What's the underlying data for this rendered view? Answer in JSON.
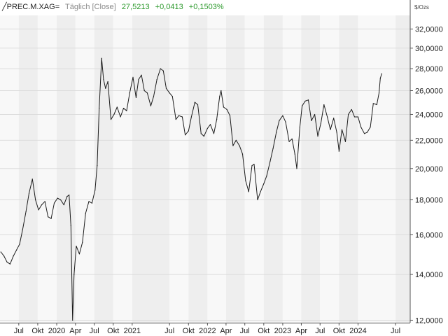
{
  "header": {
    "symbol": "╱PREC.M.XAG=",
    "period": "Täglich [Close]",
    "last": "27,5213",
    "change": "+0,0413",
    "change_pct": "+0,1503%"
  },
  "colors": {
    "line": "#1a1a1a",
    "band_light": "#f8f8f8",
    "band_dark": "#eeeeee",
    "grid": "#dcdcdc",
    "up": "#2e9a2e"
  },
  "chart_data": {
    "type": "line",
    "y_unit": "$/Ozs",
    "scale": "log",
    "ylim": [
      11.9,
      33.5
    ],
    "xlim": [
      "2019-04-01",
      "2024-09-10"
    ],
    "y_ticks": [
      "12,0000",
      "14,0000",
      "16,0000",
      "18,0000",
      "20,0000",
      "22,0000",
      "24,0000",
      "26,0000",
      "28,0000",
      "30,0000",
      "32,0000"
    ],
    "y_tick_values": [
      12,
      14,
      16,
      18,
      20,
      22,
      24,
      26,
      28,
      30,
      32
    ],
    "x_ticks": [
      {
        "date": "2019-07-01",
        "label": "Jul"
      },
      {
        "date": "2019-10-01",
        "label": "Okt"
      },
      {
        "date": "2020-01-01",
        "label": "2020"
      },
      {
        "date": "2020-04-01",
        "label": "Apr"
      },
      {
        "date": "2020-07-01",
        "label": "Jul"
      },
      {
        "date": "2020-10-01",
        "label": "Okt"
      },
      {
        "date": "2021-01-01",
        "label": "2021"
      },
      {
        "date": "2021-07-01",
        "label": "Jul"
      },
      {
        "date": "2021-10-01",
        "label": "Okt"
      },
      {
        "date": "2022-01-01",
        "label": "2022"
      },
      {
        "date": "2022-04-01",
        "label": "Apr"
      },
      {
        "date": "2022-07-01",
        "label": "Jul"
      },
      {
        "date": "2022-10-01",
        "label": "Okt"
      },
      {
        "date": "2023-01-01",
        "label": "2023"
      },
      {
        "date": "2023-04-01",
        "label": "Apr"
      },
      {
        "date": "2023-07-01",
        "label": "Jul"
      },
      {
        "date": "2023-10-01",
        "label": "Okt"
      },
      {
        "date": "2024-01-01",
        "label": "2024"
      },
      {
        "date": "2024-07-01",
        "label": "Jul"
      }
    ],
    "grid": true,
    "series": [
      {
        "x": [
          "2019-04-05",
          "2019-04-20",
          "2019-05-05",
          "2019-05-20",
          "2019-06-05",
          "2019-06-20",
          "2019-07-05",
          "2019-07-20",
          "2019-08-05",
          "2019-08-20",
          "2019-09-05",
          "2019-09-20",
          "2019-10-05",
          "2019-10-20",
          "2019-11-05",
          "2019-11-20",
          "2019-12-05",
          "2019-12-20",
          "2020-01-05",
          "2020-01-20",
          "2020-02-05",
          "2020-02-20",
          "2020-03-01",
          "2020-03-10",
          "2020-03-18",
          "2020-03-25",
          "2020-04-05",
          "2020-04-20",
          "2020-05-05",
          "2020-05-20",
          "2020-06-05",
          "2020-06-20",
          "2020-07-05",
          "2020-07-15",
          "2020-07-25",
          "2020-08-06",
          "2020-08-15",
          "2020-08-25",
          "2020-09-05",
          "2020-09-20",
          "2020-10-05",
          "2020-10-20",
          "2020-11-05",
          "2020-11-20",
          "2020-12-05",
          "2020-12-20",
          "2021-01-05",
          "2021-01-20",
          "2021-02-01",
          "2021-02-15",
          "2021-03-01",
          "2021-03-15",
          "2021-04-01",
          "2021-04-15",
          "2021-05-01",
          "2021-05-18",
          "2021-06-01",
          "2021-06-15",
          "2021-07-01",
          "2021-07-15",
          "2021-08-01",
          "2021-08-15",
          "2021-09-01",
          "2021-09-15",
          "2021-10-01",
          "2021-10-15",
          "2021-11-01",
          "2021-11-15",
          "2021-12-01",
          "2021-12-15",
          "2022-01-01",
          "2022-01-15",
          "2022-02-01",
          "2022-02-15",
          "2022-03-01",
          "2022-03-08",
          "2022-03-20",
          "2022-04-05",
          "2022-04-20",
          "2022-05-05",
          "2022-05-20",
          "2022-06-05",
          "2022-06-20",
          "2022-07-05",
          "2022-07-20",
          "2022-08-05",
          "2022-08-15",
          "2022-09-01",
          "2022-09-15",
          "2022-10-01",
          "2022-10-15",
          "2022-11-01",
          "2022-11-15",
          "2022-12-01",
          "2022-12-15",
          "2023-01-01",
          "2023-01-15",
          "2023-02-01",
          "2023-02-15",
          "2023-03-01",
          "2023-03-10",
          "2023-03-25",
          "2023-04-05",
          "2023-04-20",
          "2023-05-05",
          "2023-05-20",
          "2023-06-05",
          "2023-06-20",
          "2023-07-05",
          "2023-07-20",
          "2023-08-05",
          "2023-08-20",
          "2023-09-05",
          "2023-09-20",
          "2023-10-01",
          "2023-10-15",
          "2023-11-01",
          "2023-11-15",
          "2023-12-01",
          "2023-12-15",
          "2024-01-01",
          "2024-01-15",
          "2024-02-01",
          "2024-02-15",
          "2024-03-01",
          "2024-03-15",
          "2024-04-01",
          "2024-04-12",
          "2024-04-18",
          "2024-04-25"
        ],
        "values": [
          15.1,
          14.9,
          14.6,
          14.5,
          14.9,
          15.2,
          15.5,
          16.3,
          17.3,
          18.4,
          19.3,
          18.0,
          17.4,
          17.7,
          17.9,
          17.0,
          16.9,
          17.8,
          18.1,
          18.0,
          17.7,
          18.2,
          18.3,
          16.5,
          12.0,
          14.0,
          15.4,
          15.0,
          15.6,
          17.2,
          17.9,
          17.8,
          18.6,
          20.2,
          24.5,
          29.0,
          27.0,
          26.2,
          26.8,
          23.6,
          24.0,
          24.6,
          23.8,
          24.5,
          24.3,
          25.8,
          27.2,
          25.4,
          27.0,
          27.4,
          26.0,
          25.8,
          24.7,
          25.5,
          27.0,
          28.0,
          27.8,
          26.2,
          25.8,
          25.5,
          23.6,
          23.9,
          23.8,
          22.4,
          22.7,
          23.8,
          25.0,
          24.8,
          22.5,
          22.3,
          22.9,
          23.2,
          22.5,
          23.6,
          25.5,
          26.0,
          24.6,
          24.4,
          23.9,
          21.6,
          22.0,
          21.6,
          21.0,
          19.2,
          18.5,
          20.2,
          20.3,
          18.0,
          18.5,
          19.0,
          19.5,
          20.5,
          21.4,
          22.6,
          23.5,
          23.9,
          23.4,
          21.9,
          22.1,
          21.0,
          20.0,
          23.0,
          24.7,
          25.1,
          25.2,
          23.5,
          24.0,
          22.3,
          23.3,
          24.8,
          23.8,
          22.8,
          23.7,
          22.6,
          21.2,
          22.8,
          21.9,
          24.0,
          24.4,
          23.8,
          23.8,
          23.0,
          22.5,
          22.6,
          23.0,
          24.9,
          24.8,
          25.8,
          27.1,
          27.5213
        ]
      }
    ]
  }
}
